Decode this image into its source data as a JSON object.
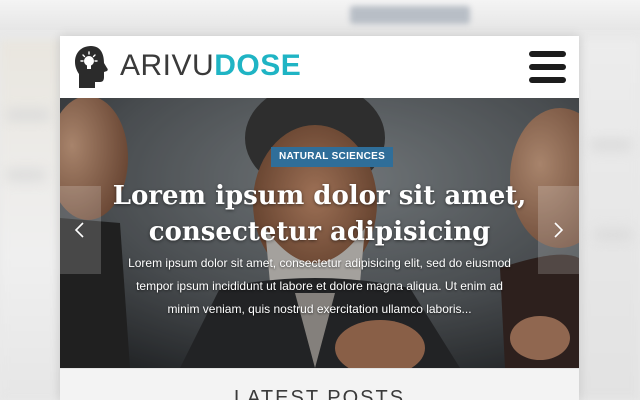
{
  "brand": {
    "name_part1": "ARIVU",
    "name_part2": "DOSE",
    "accent_color": "#1fb4c4"
  },
  "header": {
    "menu_icon": "hamburger-menu-icon"
  },
  "hero": {
    "category": "NATURAL SCIENCES",
    "category_color": "#2f6e99",
    "title_lines": [
      "Lorem ipsum dolor sit amet,",
      "consectetur adipisicing"
    ],
    "excerpt_lines": [
      "Lorem ipsum dolor sit amet, consectetur adipisicing elit, sed do eiusmod",
      "tempor ipsum incididunt ut labore et dolore magna aliqua. Ut enim ad",
      "minim veniam, quis nostrud exercitation ullamco laboris..."
    ],
    "prev_icon": "chevron-left-icon",
    "next_icon": "chevron-right-icon"
  },
  "latest": {
    "title": "LATEST POSTS"
  }
}
